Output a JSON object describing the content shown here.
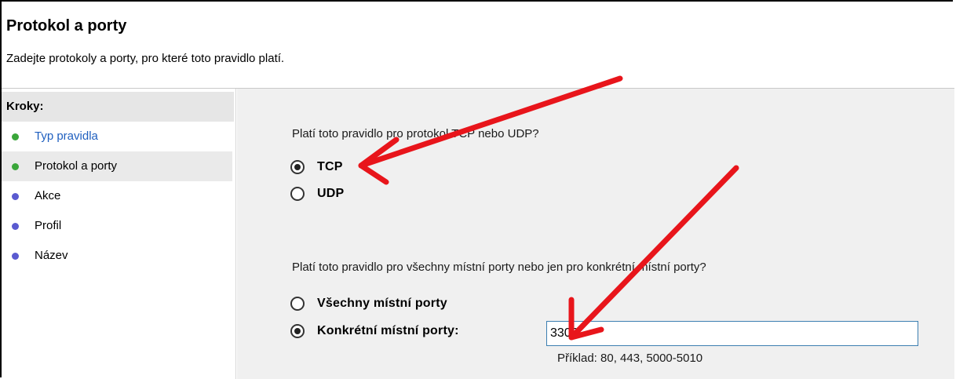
{
  "header": {
    "title": "Protokol a porty",
    "subtitle": "Zadejte protokoly a porty, pro které toto pravidlo platí."
  },
  "sidebar": {
    "heading": "Kroky:",
    "items": [
      {
        "label": "Typ pravidla",
        "dot_color": "#3aa63a",
        "link": true
      },
      {
        "label": "Protokol a porty",
        "dot_color": "#3aa63a",
        "selected": true
      },
      {
        "label": "Akce",
        "dot_color": "#5a5ad0"
      },
      {
        "label": "Profil",
        "dot_color": "#5a5ad0"
      },
      {
        "label": "Název",
        "dot_color": "#5a5ad0"
      }
    ]
  },
  "main": {
    "protocol_question": "Platí toto pravidlo pro protokol TCP nebo UDP?",
    "protocol_options": [
      {
        "label": "TCP",
        "checked": true
      },
      {
        "label": "UDP",
        "checked": false
      }
    ],
    "ports_question": "Platí toto pravidlo pro všechny místní porty nebo jen pro konkrétní místní porty?",
    "port_options": [
      {
        "label": "Všechny místní porty",
        "checked": false
      },
      {
        "label": "Konkrétní místní porty:",
        "checked": true
      }
    ],
    "port_value": "3306",
    "port_hint": "Příklad: 80, 443, 5000-5010"
  },
  "annotation_color": "#e8151b"
}
